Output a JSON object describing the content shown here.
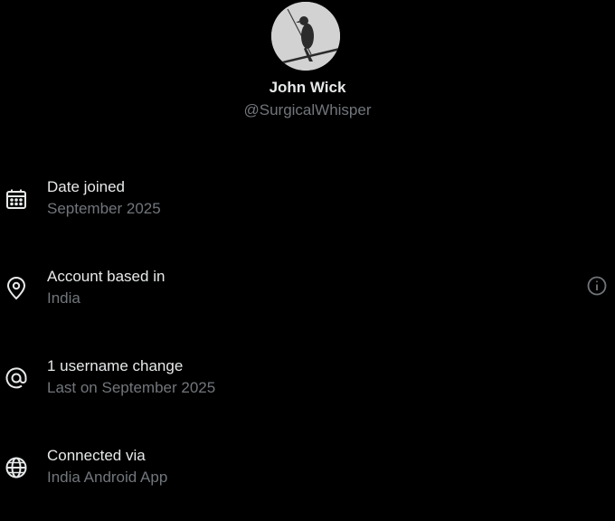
{
  "profile": {
    "display_name": "John Wick",
    "handle": "@SurgicalWhisper"
  },
  "details": [
    {
      "icon": "calendar-icon",
      "title": "Date joined",
      "subtitle": "September 2025"
    },
    {
      "icon": "location-pin-icon",
      "title": "Account based in",
      "subtitle": "India"
    },
    {
      "icon": "at-sign-icon",
      "title": "1 username change",
      "subtitle": "Last on September 2025"
    },
    {
      "icon": "globe-icon",
      "title": "Connected via",
      "subtitle": "India Android App"
    }
  ],
  "colors": {
    "background": "#000000",
    "primary_text": "#e7e9ea",
    "secondary_text": "#71767b"
  }
}
